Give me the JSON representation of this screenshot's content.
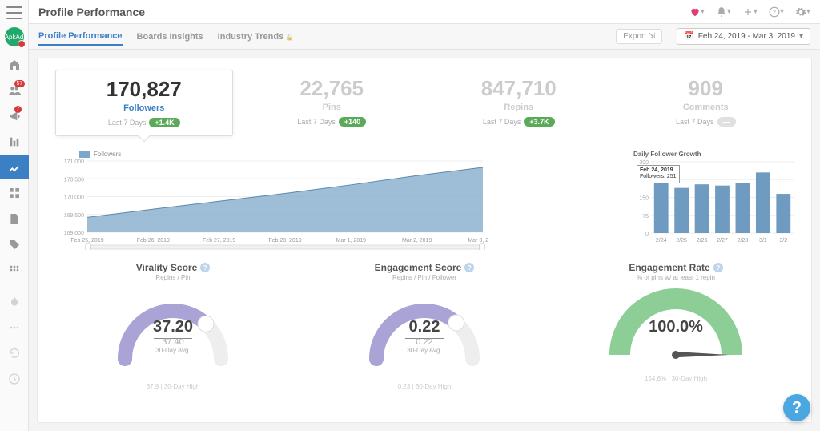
{
  "page_title": "Profile Performance",
  "tabs": [
    "Profile Performance",
    "Boards Insights",
    "Industry Trends"
  ],
  "export_label": "Export",
  "date_range": "Feb 24, 2019 - Mar 3, 2019",
  "avatar_text": "ApkAd",
  "kpis": [
    {
      "value": "170,827",
      "label": "Followers",
      "sub": "Last 7 Days",
      "delta": "+1.4K",
      "selected": true
    },
    {
      "value": "22,765",
      "label": "Pins",
      "sub": "Last 7 Days",
      "delta": "+140"
    },
    {
      "value": "847,710",
      "label": "Repins",
      "sub": "Last 7 Days",
      "delta": "+3.7K"
    },
    {
      "value": "909",
      "label": "Comments",
      "sub": "Last 7 Days",
      "delta": ""
    }
  ],
  "line_legend": "Followers",
  "chart_data": {
    "line": {
      "type": "area",
      "ylabel": "",
      "y_ticks": [
        169000,
        169500,
        170000,
        170500,
        171000
      ],
      "categories": [
        "Feb 25, 2019",
        "Feb 26, 2019",
        "Feb 27, 2019",
        "Feb 28, 2019",
        "Mar 1, 2019",
        "Mar 2, 2019",
        "Mar 3, 2019"
      ],
      "series": [
        {
          "name": "Followers",
          "values": [
            169420,
            169650,
            169870,
            170090,
            170330,
            170590,
            170820
          ]
        }
      ]
    },
    "bar": {
      "type": "bar",
      "title": "Daily Follower Growth",
      "y_ticks": [
        0,
        75,
        150,
        225,
        300
      ],
      "categories": [
        "2/24",
        "2/25",
        "2/26",
        "2/27",
        "2/28",
        "3/1",
        "3/2"
      ],
      "values": [
        251,
        190,
        205,
        200,
        210,
        255,
        165
      ],
      "tooltip": {
        "date": "Feb 24, 2019",
        "label": "Followers: 251"
      }
    },
    "gauges": [
      {
        "title": "Virality Score",
        "sub": "Repins / Pin",
        "value": "37.20",
        "avg": "37.40",
        "avg_label": "30-Day Avg.",
        "footer": "37.9 | 30-Day High",
        "pct": 0.74,
        "color": "#a9a3d6"
      },
      {
        "title": "Engagement Score",
        "sub": "Repins / Pin / Follower",
        "value": "0.22",
        "avg": "0.22",
        "avg_label": "30-Day Avg.",
        "footer": "0.23 | 30-Day High",
        "pct": 0.73,
        "color": "#a9a3d6"
      },
      {
        "title": "Engagement Rate",
        "sub": "% of pins w/ at least 1 repin",
        "value": "100.0%",
        "avg": "",
        "avg_label": "",
        "footer": "154.6% | 30-Day High",
        "pct": 1.0,
        "color": "#7fc98b",
        "needle": true
      }
    ]
  }
}
